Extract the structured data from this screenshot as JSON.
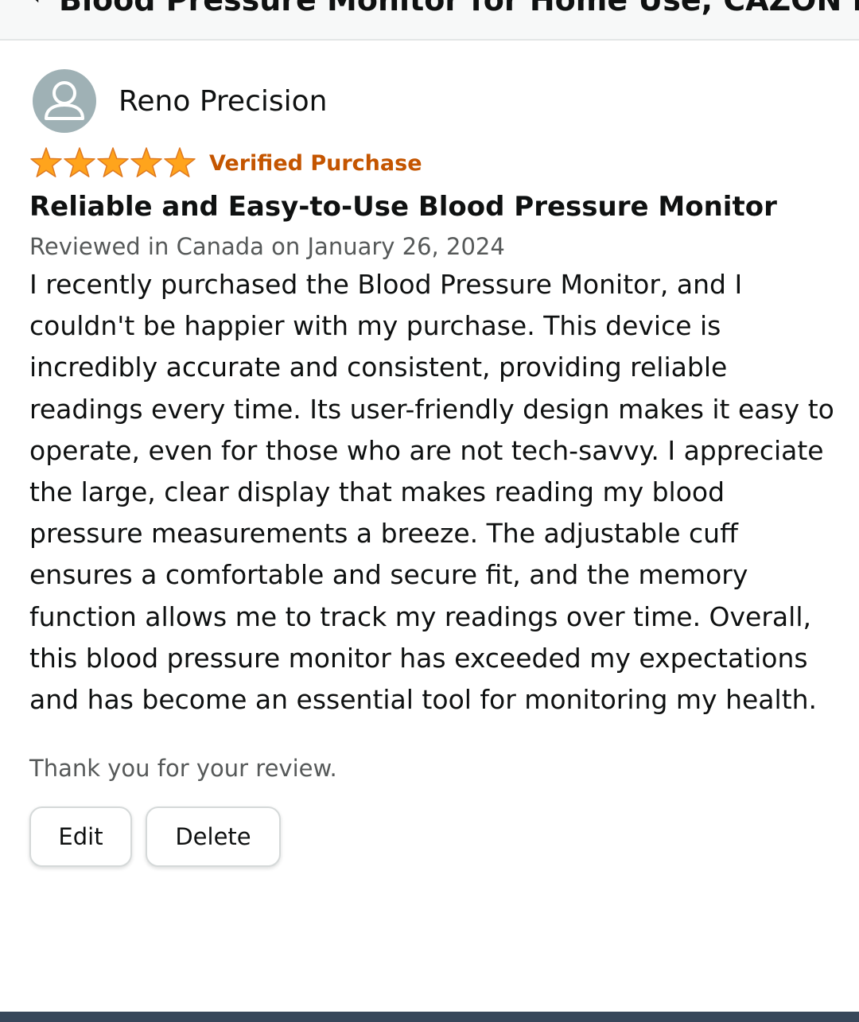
{
  "header": {
    "back_icon": "chevron-left-icon",
    "product_title": "Blood Pressure Monitor for Home Use, CAZON Blo..."
  },
  "review": {
    "reviewer_name": "Reno Precision",
    "avatar_icon": "user-avatar-icon",
    "rating": 5,
    "rating_max": 5,
    "star_color": "#ffa41c",
    "verified_label": "Verified Purchase",
    "verified_color": "#c45500",
    "title": "Reliable and Easy-to-Use Blood Pressure Monitor",
    "date_line": "Reviewed in Canada on January 26, 2024",
    "body": "I recently purchased the Blood Pressure Monitor, and I couldn't be happier with my purchase. This device is incredibly accurate and consistent, providing reliable readings every time. Its user-friendly design makes it easy to operate, even for those who are not tech-savvy. I appreciate the large, clear display that makes reading my blood pressure measurements a breeze. The adjustable cuff ensures a comfortable and secure fit, and the memory function allows me to track my readings over time. Overall, this blood pressure monitor has exceeded my expectations and has become an essential tool for monitoring my health.",
    "thanks_text": "Thank you for your review."
  },
  "actions": {
    "edit_label": "Edit",
    "delete_label": "Delete"
  },
  "colors": {
    "bottom_bar": "#37475a",
    "header_bg": "#f7f8f8"
  }
}
